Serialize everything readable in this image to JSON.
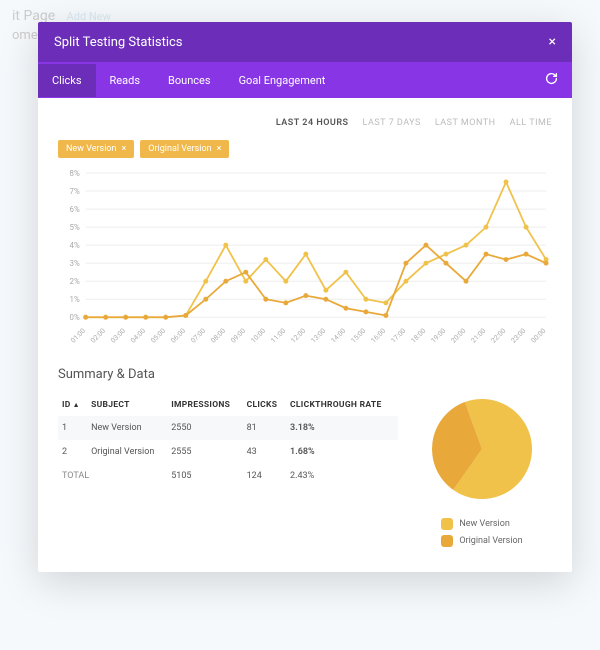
{
  "backdrop": {
    "title": "it Page",
    "addNew": "Add New",
    "subtitle": "ome"
  },
  "modal": {
    "title": "Split Testing Statistics"
  },
  "tabs": {
    "items": [
      {
        "label": "Clicks",
        "active": true
      },
      {
        "label": "Reads",
        "active": false
      },
      {
        "label": "Bounces",
        "active": false
      },
      {
        "label": "Goal Engagement",
        "active": false
      }
    ]
  },
  "timeranges": {
    "items": [
      {
        "label": "LAST 24 HOURS",
        "active": true
      },
      {
        "label": "LAST 7 DAYS",
        "active": false
      },
      {
        "label": "LAST MONTH",
        "active": false
      },
      {
        "label": "ALL TIME",
        "active": false
      }
    ]
  },
  "chips": {
    "items": [
      {
        "label": "New Version"
      },
      {
        "label": "Original Version"
      }
    ]
  },
  "summary": {
    "title": "Summary & Data",
    "headers": {
      "id": "ID",
      "subject": "SUBJECT",
      "impressions": "IMPRESSIONS",
      "clicks": "CLICKS",
      "ctr": "CLICKTHROUGH RATE"
    },
    "rows": [
      {
        "id": "1",
        "subject": "New Version",
        "impressions": "2550",
        "clicks": "81",
        "ctr": "3.18%"
      },
      {
        "id": "2",
        "subject": "Original Version",
        "impressions": "2555",
        "clicks": "43",
        "ctr": "1.68%"
      }
    ],
    "total": {
      "label": "TOTAL",
      "impressions": "5105",
      "clicks": "124",
      "ctr": "2.43%"
    }
  },
  "legend": {
    "items": [
      {
        "label": "New Version",
        "color": "#f0c24a"
      },
      {
        "label": "Original Version",
        "color": "#e8a93a"
      }
    ]
  },
  "colors": {
    "purpleDark": "#6c2eb9",
    "purple": "#8836e5",
    "seriesA": "#f0c24a",
    "seriesB": "#e8a93a",
    "grid": "#eeeeee"
  },
  "chart_data": {
    "type": "line",
    "title": "",
    "xlabel": "",
    "ylabel": "",
    "ylim": [
      0,
      8
    ],
    "y_ticks_pct": [
      0,
      1,
      2,
      3,
      4,
      5,
      6,
      7,
      8
    ],
    "categories": [
      "01:00",
      "02:00",
      "03:00",
      "04:00",
      "05:00",
      "06:00",
      "07:00",
      "08:00",
      "09:00",
      "10:00",
      "11:00",
      "12:00",
      "13:00",
      "14:00",
      "15:00",
      "16:00",
      "17:00",
      "18:00",
      "19:00",
      "20:00",
      "21:00",
      "22:00",
      "23:00",
      "00:00"
    ],
    "series": [
      {
        "name": "New Version",
        "values": [
          0,
          0,
          0,
          0,
          0,
          0.1,
          2,
          4,
          2,
          3.2,
          2,
          3.5,
          1.5,
          2.5,
          1,
          0.8,
          2,
          3,
          3.5,
          4,
          5,
          7.5,
          5,
          3.2
        ]
      },
      {
        "name": "Original Version",
        "values": [
          0,
          0,
          0,
          0,
          0,
          0.1,
          1,
          2,
          2.5,
          1,
          0.8,
          1.2,
          1,
          0.5,
          0.3,
          0.1,
          3,
          4,
          3,
          2,
          3.5,
          3.2,
          3.5,
          3
        ]
      }
    ],
    "pie": {
      "type": "pie",
      "slices": [
        {
          "label": "New Version",
          "value": 81
        },
        {
          "label": "Original Version",
          "value": 43
        }
      ]
    }
  }
}
